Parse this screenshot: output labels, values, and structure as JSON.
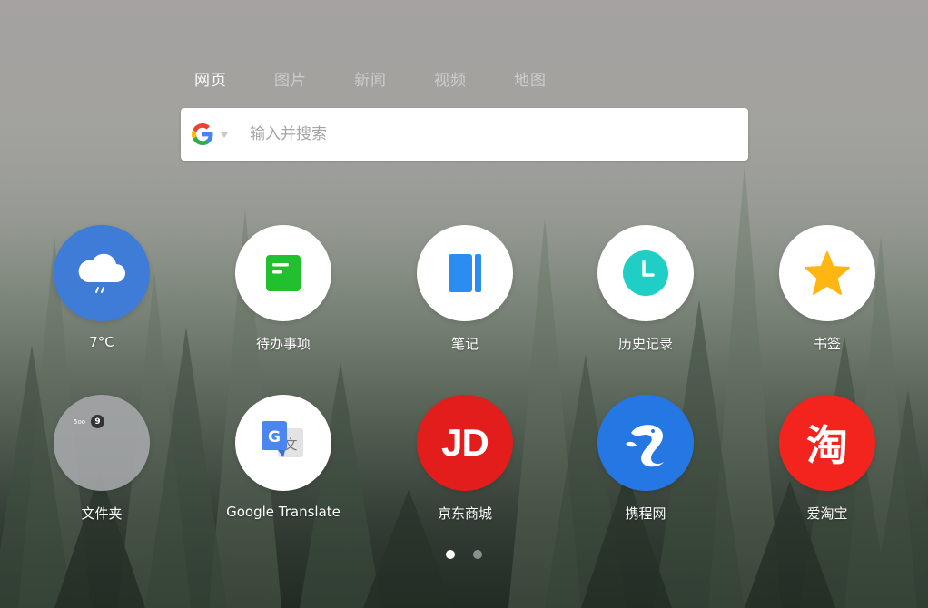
{
  "search_tabs": [
    {
      "label": "网页",
      "active": true
    },
    {
      "label": "图片",
      "active": false
    },
    {
      "label": "新闻",
      "active": false
    },
    {
      "label": "视频",
      "active": false
    },
    {
      "label": "地图",
      "active": false
    }
  ],
  "search": {
    "engine_icon": "google-icon",
    "placeholder": "输入并搜索"
  },
  "tiles": [
    {
      "label": "7°C",
      "icon": "weather-icon",
      "color": "#3f7cd8"
    },
    {
      "label": "待办事项",
      "icon": "todo-icon",
      "color": "#22c02e"
    },
    {
      "label": "笔记",
      "icon": "notes-icon",
      "color": "#2b8df2"
    },
    {
      "label": "历史记录",
      "icon": "history-clock-icon",
      "color": "#1fcfc6"
    },
    {
      "label": "书签",
      "icon": "star-icon",
      "color": "#ffb613"
    },
    {
      "label": "文件夹",
      "icon": "folder-icon",
      "color": "#a7a9ab"
    },
    {
      "label": "Google Translate",
      "icon": "google-translate-icon",
      "color": "#4a85f0"
    },
    {
      "label": "京东商城",
      "icon": "jd-logo-icon",
      "color": "#e31d1c"
    },
    {
      "label": "携程网",
      "icon": "ctrip-dolphin-icon",
      "color": "#2577e3"
    },
    {
      "label": "爱淘宝",
      "icon": "taobao-logo-icon",
      "color": "#f3241e"
    }
  ],
  "folder_preview": {
    "mini_text": "5oo"
  },
  "jd_logo_text": "JD",
  "taobao_logo_text": "淘",
  "pager": {
    "pages": 2,
    "current": 1
  }
}
